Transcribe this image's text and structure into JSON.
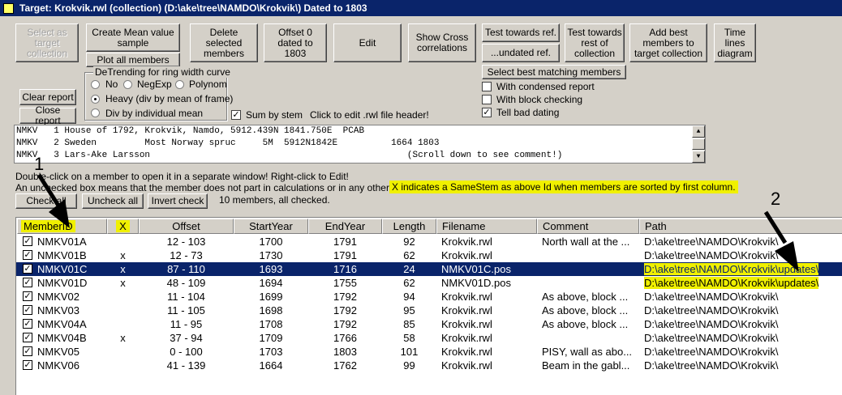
{
  "window": {
    "title": "Target: Krokvik.rwl (collection)  (D:\\ake\\tree\\NAMDO\\Krokvik\\) Dated to 1803"
  },
  "toolbar": {
    "select_target": "Select as target collection",
    "create_mean": "Create Mean value sample",
    "plot_all": "Plot all members",
    "delete_selected": "Delete selected members",
    "offset_dated": "Offset 0 dated to 1803",
    "edit": "Edit",
    "show_cross": "Show Cross correlations",
    "test_towards_ref": "Test towards ref.",
    "undated_ref": "...undated ref.",
    "test_towards_rest": "Test towards rest of collection",
    "add_best": "Add best members to target collection",
    "time_lines": "Time lines diagram",
    "select_best": "Select best matching members",
    "clear_report": "Clear report",
    "close_report": "Close report"
  },
  "options": {
    "condensed_report": "With condensed report",
    "block_checking": "With block checking",
    "tell_bad_dating": "Tell bad dating",
    "sum_by_stem": "Sum by stem",
    "edit_header_hint": "Click to edit .rwl file header!"
  },
  "detrending": {
    "title": "DeTrending for ring width curve",
    "no": "No",
    "negexp": "NegExp",
    "polynom": "Polynom",
    "heavy": "Heavy (div by mean of frame)",
    "div_individual": "Div by individual mean"
  },
  "header_text": {
    "lines": [
      "NMKV   1 House of 1792, Krokvik, Namdo, 5912.439N 1841.750E  PCAB",
      "NMKV   2 Sweden         Most Norway spruc     5M  5912N1842E          1664 1803",
      "NMKV   3 Lars-Ake Larsson                                                (Scroll down to see comment!)"
    ]
  },
  "info": {
    "line1": "Double-click on a member to open it in a separate window! Right-click to Edit!",
    "line2": "An unchecked box means that the member does not part in calculations or in any other operation.",
    "samestem_note": "X indicates a SameStem as above Id when members are sorted by first column.",
    "members_count": "10 members, all checked."
  },
  "check_buttons": {
    "check_all": "Check all",
    "uncheck_all": "Uncheck all",
    "invert_check": "Invert check"
  },
  "table": {
    "headers": [
      "MemberID",
      "X",
      "Offset",
      "StartYear",
      "EndYear",
      "Length",
      "Filename",
      "Comment",
      "Path"
    ],
    "rows": [
      {
        "id": "NMKV01A",
        "x": "",
        "offset": "12 - 103",
        "start": "1700",
        "end": "1791",
        "length": "92",
        "file": "Krokvik.rwl",
        "comment": "North wall at the ...",
        "path": "D:\\ake\\tree\\NAMDO\\Krokvik\\"
      },
      {
        "id": "NMKV01B",
        "x": "x",
        "offset": "12 -  73",
        "start": "1730",
        "end": "1791",
        "length": "62",
        "file": "Krokvik.rwl",
        "comment": "",
        "path": "D:\\ake\\tree\\NAMDO\\Krokvik\\"
      },
      {
        "id": "NMKV01C",
        "x": "x",
        "offset": "87 - 110",
        "start": "1693",
        "end": "1716",
        "length": "24",
        "file": "NMKV01C.pos",
        "comment": "",
        "path": "D:\\ake\\tree\\NAMDO\\Krokvik\\updates\\"
      },
      {
        "id": "NMKV01D",
        "x": "x",
        "offset": "48 - 109",
        "start": "1694",
        "end": "1755",
        "length": "62",
        "file": "NMKV01D.pos",
        "comment": "",
        "path": "D:\\ake\\tree\\NAMDO\\Krokvik\\updates\\"
      },
      {
        "id": "NMKV02",
        "x": "",
        "offset": "11 - 104",
        "start": "1699",
        "end": "1792",
        "length": "94",
        "file": "Krokvik.rwl",
        "comment": "As above, block ...",
        "path": "D:\\ake\\tree\\NAMDO\\Krokvik\\"
      },
      {
        "id": "NMKV03",
        "x": "",
        "offset": "11 - 105",
        "start": "1698",
        "end": "1792",
        "length": "95",
        "file": "Krokvik.rwl",
        "comment": "As above, block ...",
        "path": "D:\\ake\\tree\\NAMDO\\Krokvik\\"
      },
      {
        "id": "NMKV04A",
        "x": "",
        "offset": "11 -  95",
        "start": "1708",
        "end": "1792",
        "length": "85",
        "file": "Krokvik.rwl",
        "comment": "As above, block ...",
        "path": "D:\\ake\\tree\\NAMDO\\Krokvik\\"
      },
      {
        "id": "NMKV04B",
        "x": "x",
        "offset": "37 -  94",
        "start": "1709",
        "end": "1766",
        "length": "58",
        "file": "Krokvik.rwl",
        "comment": "",
        "path": "D:\\ake\\tree\\NAMDO\\Krokvik\\"
      },
      {
        "id": "NMKV05",
        "x": "",
        "offset": "0 - 100",
        "start": "1703",
        "end": "1803",
        "length": "101",
        "file": "Krokvik.rwl",
        "comment": "PISY, wall as abo...",
        "path": "D:\\ake\\tree\\NAMDO\\Krokvik\\"
      },
      {
        "id": "NMKV06",
        "x": "",
        "offset": "41 - 139",
        "start": "1664",
        "end": "1762",
        "length": "99",
        "file": "Krokvik.rwl",
        "comment": "Beam in the gabl...",
        "path": "D:\\ake\\tree\\NAMDO\\Krokvik\\"
      }
    ]
  },
  "annotations": {
    "one": "1",
    "two": "2"
  }
}
